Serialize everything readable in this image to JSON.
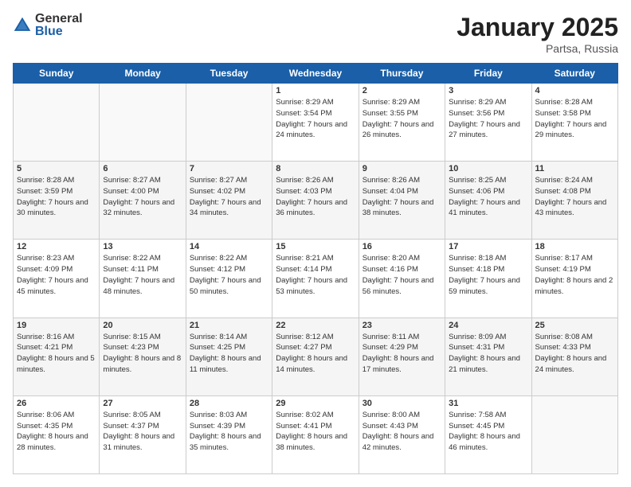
{
  "header": {
    "logo_general": "General",
    "logo_blue": "Blue",
    "month_title": "January 2025",
    "location": "Partsa, Russia"
  },
  "days_of_week": [
    "Sunday",
    "Monday",
    "Tuesday",
    "Wednesday",
    "Thursday",
    "Friday",
    "Saturday"
  ],
  "weeks": [
    [
      {
        "day": "",
        "info": ""
      },
      {
        "day": "",
        "info": ""
      },
      {
        "day": "",
        "info": ""
      },
      {
        "day": "1",
        "sunrise": "Sunrise: 8:29 AM",
        "sunset": "Sunset: 3:54 PM",
        "daylight": "Daylight: 7 hours and 24 minutes."
      },
      {
        "day": "2",
        "sunrise": "Sunrise: 8:29 AM",
        "sunset": "Sunset: 3:55 PM",
        "daylight": "Daylight: 7 hours and 26 minutes."
      },
      {
        "day": "3",
        "sunrise": "Sunrise: 8:29 AM",
        "sunset": "Sunset: 3:56 PM",
        "daylight": "Daylight: 7 hours and 27 minutes."
      },
      {
        "day": "4",
        "sunrise": "Sunrise: 8:28 AM",
        "sunset": "Sunset: 3:58 PM",
        "daylight": "Daylight: 7 hours and 29 minutes."
      }
    ],
    [
      {
        "day": "5",
        "sunrise": "Sunrise: 8:28 AM",
        "sunset": "Sunset: 3:59 PM",
        "daylight": "Daylight: 7 hours and 30 minutes."
      },
      {
        "day": "6",
        "sunrise": "Sunrise: 8:27 AM",
        "sunset": "Sunset: 4:00 PM",
        "daylight": "Daylight: 7 hours and 32 minutes."
      },
      {
        "day": "7",
        "sunrise": "Sunrise: 8:27 AM",
        "sunset": "Sunset: 4:02 PM",
        "daylight": "Daylight: 7 hours and 34 minutes."
      },
      {
        "day": "8",
        "sunrise": "Sunrise: 8:26 AM",
        "sunset": "Sunset: 4:03 PM",
        "daylight": "Daylight: 7 hours and 36 minutes."
      },
      {
        "day": "9",
        "sunrise": "Sunrise: 8:26 AM",
        "sunset": "Sunset: 4:04 PM",
        "daylight": "Daylight: 7 hours and 38 minutes."
      },
      {
        "day": "10",
        "sunrise": "Sunrise: 8:25 AM",
        "sunset": "Sunset: 4:06 PM",
        "daylight": "Daylight: 7 hours and 41 minutes."
      },
      {
        "day": "11",
        "sunrise": "Sunrise: 8:24 AM",
        "sunset": "Sunset: 4:08 PM",
        "daylight": "Daylight: 7 hours and 43 minutes."
      }
    ],
    [
      {
        "day": "12",
        "sunrise": "Sunrise: 8:23 AM",
        "sunset": "Sunset: 4:09 PM",
        "daylight": "Daylight: 7 hours and 45 minutes."
      },
      {
        "day": "13",
        "sunrise": "Sunrise: 8:22 AM",
        "sunset": "Sunset: 4:11 PM",
        "daylight": "Daylight: 7 hours and 48 minutes."
      },
      {
        "day": "14",
        "sunrise": "Sunrise: 8:22 AM",
        "sunset": "Sunset: 4:12 PM",
        "daylight": "Daylight: 7 hours and 50 minutes."
      },
      {
        "day": "15",
        "sunrise": "Sunrise: 8:21 AM",
        "sunset": "Sunset: 4:14 PM",
        "daylight": "Daylight: 7 hours and 53 minutes."
      },
      {
        "day": "16",
        "sunrise": "Sunrise: 8:20 AM",
        "sunset": "Sunset: 4:16 PM",
        "daylight": "Daylight: 7 hours and 56 minutes."
      },
      {
        "day": "17",
        "sunrise": "Sunrise: 8:18 AM",
        "sunset": "Sunset: 4:18 PM",
        "daylight": "Daylight: 7 hours and 59 minutes."
      },
      {
        "day": "18",
        "sunrise": "Sunrise: 8:17 AM",
        "sunset": "Sunset: 4:19 PM",
        "daylight": "Daylight: 8 hours and 2 minutes."
      }
    ],
    [
      {
        "day": "19",
        "sunrise": "Sunrise: 8:16 AM",
        "sunset": "Sunset: 4:21 PM",
        "daylight": "Daylight: 8 hours and 5 minutes."
      },
      {
        "day": "20",
        "sunrise": "Sunrise: 8:15 AM",
        "sunset": "Sunset: 4:23 PM",
        "daylight": "Daylight: 8 hours and 8 minutes."
      },
      {
        "day": "21",
        "sunrise": "Sunrise: 8:14 AM",
        "sunset": "Sunset: 4:25 PM",
        "daylight": "Daylight: 8 hours and 11 minutes."
      },
      {
        "day": "22",
        "sunrise": "Sunrise: 8:12 AM",
        "sunset": "Sunset: 4:27 PM",
        "daylight": "Daylight: 8 hours and 14 minutes."
      },
      {
        "day": "23",
        "sunrise": "Sunrise: 8:11 AM",
        "sunset": "Sunset: 4:29 PM",
        "daylight": "Daylight: 8 hours and 17 minutes."
      },
      {
        "day": "24",
        "sunrise": "Sunrise: 8:09 AM",
        "sunset": "Sunset: 4:31 PM",
        "daylight": "Daylight: 8 hours and 21 minutes."
      },
      {
        "day": "25",
        "sunrise": "Sunrise: 8:08 AM",
        "sunset": "Sunset: 4:33 PM",
        "daylight": "Daylight: 8 hours and 24 minutes."
      }
    ],
    [
      {
        "day": "26",
        "sunrise": "Sunrise: 8:06 AM",
        "sunset": "Sunset: 4:35 PM",
        "daylight": "Daylight: 8 hours and 28 minutes."
      },
      {
        "day": "27",
        "sunrise": "Sunrise: 8:05 AM",
        "sunset": "Sunset: 4:37 PM",
        "daylight": "Daylight: 8 hours and 31 minutes."
      },
      {
        "day": "28",
        "sunrise": "Sunrise: 8:03 AM",
        "sunset": "Sunset: 4:39 PM",
        "daylight": "Daylight: 8 hours and 35 minutes."
      },
      {
        "day": "29",
        "sunrise": "Sunrise: 8:02 AM",
        "sunset": "Sunset: 4:41 PM",
        "daylight": "Daylight: 8 hours and 38 minutes."
      },
      {
        "day": "30",
        "sunrise": "Sunrise: 8:00 AM",
        "sunset": "Sunset: 4:43 PM",
        "daylight": "Daylight: 8 hours and 42 minutes."
      },
      {
        "day": "31",
        "sunrise": "Sunrise: 7:58 AM",
        "sunset": "Sunset: 4:45 PM",
        "daylight": "Daylight: 8 hours and 46 minutes."
      },
      {
        "day": "",
        "info": ""
      }
    ]
  ]
}
